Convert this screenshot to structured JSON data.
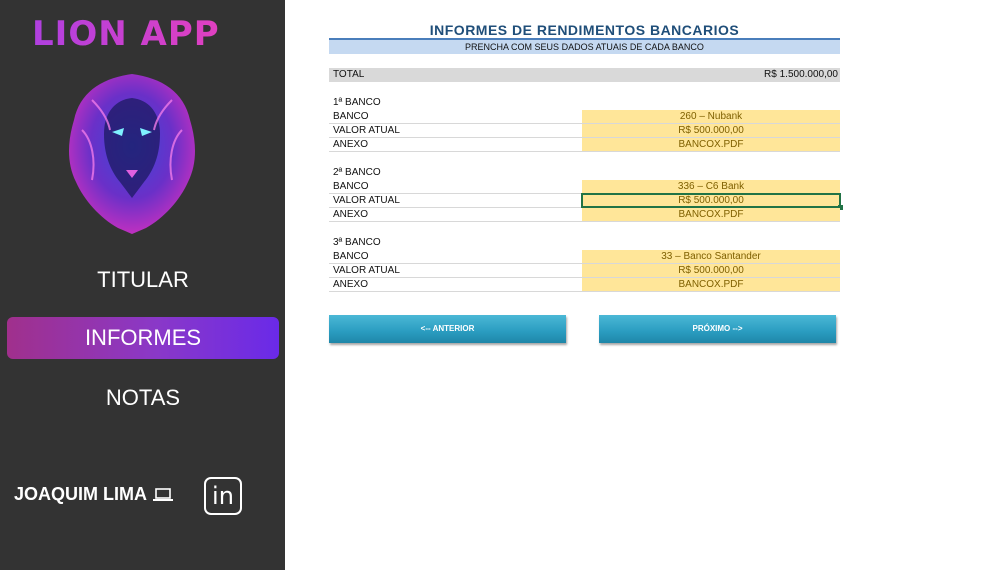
{
  "sidebar": {
    "app_title": "LION APP",
    "nav": [
      {
        "label": "TITULAR",
        "active": false
      },
      {
        "label": "INFORMES",
        "active": true
      },
      {
        "label": "NOTAS",
        "active": false
      }
    ],
    "author": "JOAQUIM LIMA",
    "linkedin_icon_text": "in"
  },
  "sheet": {
    "title": "INFORMES DE RENDIMENTOS BANCARIOS",
    "subtitle": "PRENCHA COM SEUS DADOS ATUAIS DE CADA BANCO",
    "total_label": "TOTAL",
    "total_value": "R$ 1.500.000,00",
    "banks": [
      {
        "heading": "1ª BANCO",
        "rows": [
          {
            "label": "BANCO",
            "value": "260 – Nubank"
          },
          {
            "label": "VALOR ATUAL",
            "value": "R$ 500.000,00"
          },
          {
            "label": "ANEXO",
            "value": "BANCOX.PDF"
          }
        ]
      },
      {
        "heading": "2ª BANCO",
        "rows": [
          {
            "label": "BANCO",
            "value": "336 – C6 Bank"
          },
          {
            "label": "VALOR ATUAL",
            "value": "R$ 500.000,00"
          },
          {
            "label": "ANEXO",
            "value": "BANCOX.PDF"
          }
        ]
      },
      {
        "heading": "3ª BANCO",
        "rows": [
          {
            "label": "BANCO",
            "value": "33 – Banco Santander"
          },
          {
            "label": "VALOR ATUAL",
            "value": "R$ 500.000,00"
          },
          {
            "label": "ANEXO",
            "value": "BANCOX.PDF"
          }
        ]
      }
    ],
    "buttons": {
      "previous": "<-- ANTERIOR",
      "next": "PRÓXIMO -->"
    }
  },
  "colors": {
    "sidebar_bg": "#333333",
    "active_nav_gradient_start": "#a0308c",
    "active_nav_gradient_end": "#6a2ae8",
    "input_cell": "#ffe699",
    "button": "#2a9cc0"
  }
}
